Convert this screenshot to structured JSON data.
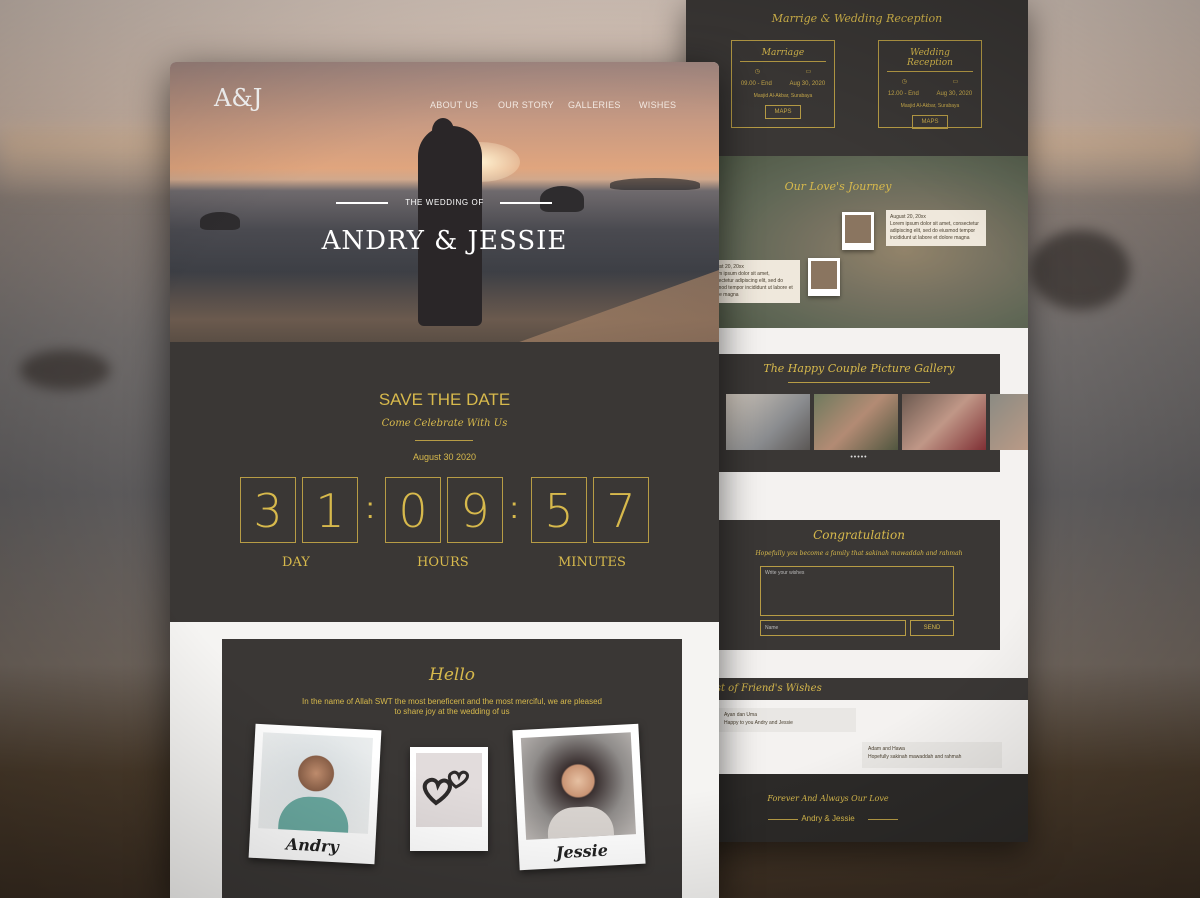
{
  "main": {
    "logo": "A&J",
    "nav": [
      "ABOUT US",
      "OUR STORY",
      "GALLERIES",
      "WISHES"
    ],
    "hero_pre": "THE WEDDING OF",
    "hero_title": "ANDRY & JESSIE",
    "save": {
      "title": "SAVE THE DATE",
      "subtitle": "Come Celebrate With Us",
      "date": "August 30 2020",
      "digits": [
        "3",
        "1",
        "0",
        "9",
        "5",
        "7"
      ],
      "units": [
        "DAY",
        "HOURS",
        "MINUTES"
      ]
    },
    "hello": {
      "title": "Hello",
      "text1": "In the name of Allah SWT the most beneficent and the most merciful, we are pleased",
      "text2": "to share joy at the wedding of us",
      "groom": "Andry",
      "bride": "Jessie"
    }
  },
  "side": {
    "events_title": "Marrige & Wedding Reception",
    "events": [
      {
        "title": "Marriage",
        "time": "09.00 - End",
        "date": "Aug 30, 2020",
        "place": "Masjid Al-Akbar, Surabaya",
        "btn": "MAPS"
      },
      {
        "title": "Wedding Reception",
        "time": "12.00 - End",
        "date": "Aug 30, 2020",
        "place": "Masjid Al-Akbar, Surabaya",
        "btn": "MAPS"
      }
    ],
    "journey_title": "Our Love's Journey",
    "journey_notes": [
      {
        "date": "August 20, 20xx",
        "text": "Lorem ipsum dolor sit amet, consectetur adipiscing elit, sed do eiusmod tempor incididunt ut labore et dolore magna"
      },
      {
        "date": "August 20, 20xx",
        "text": "Lorem ipsum dolor sit amet, consectetur adipiscing elit, sed do eiusmod tempor incididunt ut labore et dolore magna"
      }
    ],
    "gallery_title": "The Happy Couple Picture Gallery",
    "gallery_dots": "•••••",
    "congrat_title": "Congratulation",
    "congrat_sub": "Hopefully you become a family that sakinah mawaddah and rahmah",
    "wish_placeholder": "Write your wishes",
    "name_placeholder": "Name",
    "send": "SEND",
    "wishes_title": "List of Friend's Wishes",
    "wishes": [
      {
        "name": "Ayan dan Uma",
        "text": "Happy to you Andry and Jessie"
      },
      {
        "name": "Adam and Hawa",
        "text": "Hopefully sakinah mawaddah and rahmah"
      }
    ],
    "footer_title": "Forever And Always Our Love",
    "footer_names": "Andry & Jessie"
  },
  "colors": {
    "gold": "#d7b94c",
    "dark": "#3a3735",
    "light": "#f4f2f0"
  }
}
